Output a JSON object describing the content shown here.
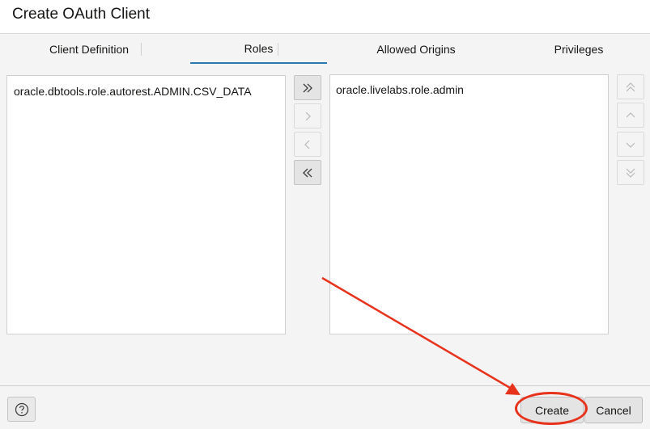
{
  "dialog": {
    "title": "Create OAuth Client"
  },
  "tabs": [
    {
      "label": "Client Definition"
    },
    {
      "label": "Roles",
      "active": true
    },
    {
      "label": "Allowed Origins"
    },
    {
      "label": "Privileges"
    }
  ],
  "roles": {
    "available": [
      "oracle.dbtools.role.autorest.ADMIN.CSV_DATA"
    ],
    "selected": [
      "oracle.livelabs.role.admin"
    ]
  },
  "shuttle_controls": {
    "move_all_right": {
      "icon": "double-chevron-right-icon",
      "enabled": true
    },
    "move_right": {
      "icon": "chevron-right-icon",
      "enabled": false
    },
    "move_left": {
      "icon": "chevron-left-icon",
      "enabled": false
    },
    "move_all_left": {
      "icon": "double-chevron-left-icon",
      "enabled": true
    }
  },
  "order_controls": {
    "move_top": {
      "icon": "double-chevron-up-icon",
      "enabled": false
    },
    "move_up": {
      "icon": "chevron-up-icon",
      "enabled": false
    },
    "move_down": {
      "icon": "chevron-down-icon",
      "enabled": false
    },
    "move_bottom": {
      "icon": "double-chevron-down-icon",
      "enabled": false
    }
  },
  "footer": {
    "help_icon": "help-circle-icon",
    "create_label": "Create",
    "cancel_label": "Cancel"
  },
  "annotation": {
    "color": "#e8331c",
    "target": "Create"
  },
  "colors": {
    "accent": "#2a7ab0",
    "annotation": "#e8331c"
  }
}
